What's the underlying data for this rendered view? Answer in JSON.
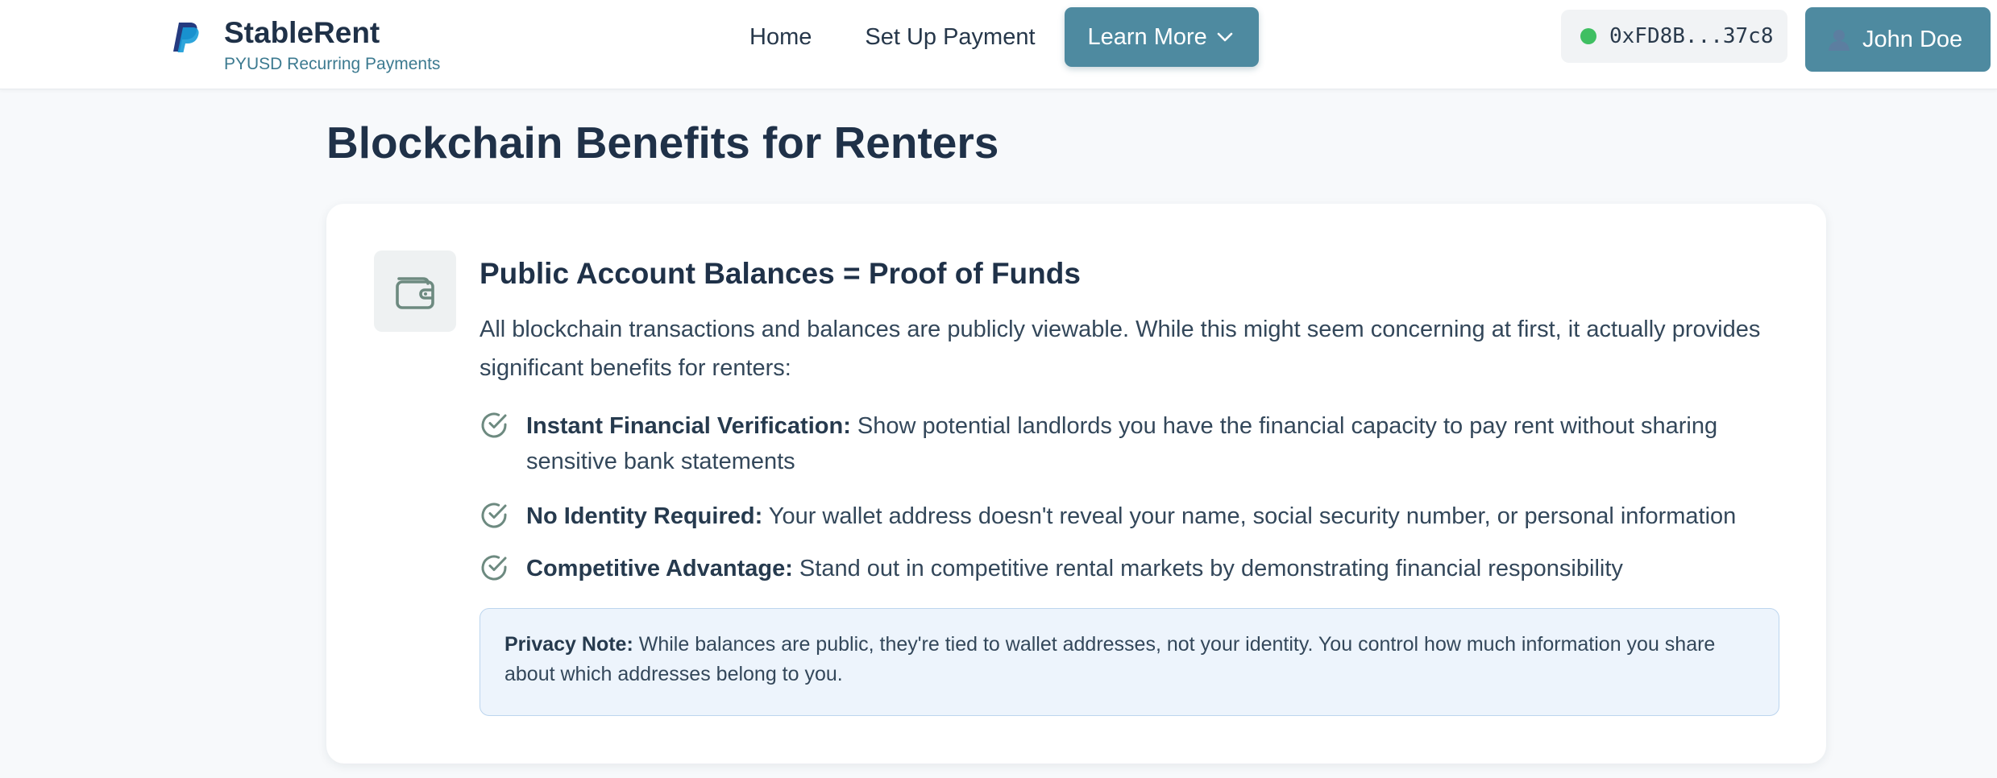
{
  "header": {
    "brand_name": "StableRent",
    "brand_subtitle": "PYUSD Recurring Payments",
    "logo_icon": "paypal-logo-icon",
    "nav": {
      "home_label": "Home",
      "setup_label": "Set Up Payment",
      "learn_more_label": "Learn More"
    },
    "wallet": {
      "address": "0xFD8B...37c8",
      "status": "connected",
      "status_color": "#3fbf62"
    },
    "user": {
      "name": "John Doe",
      "icon": "user-avatar-icon"
    }
  },
  "main": {
    "page_title": "Blockchain Benefits for Renters",
    "card": {
      "icon": "wallet-icon",
      "title": "Public Account Balances = Proof of Funds",
      "description": "All blockchain transactions and balances are publicly viewable. While this might seem concerning at first, it actually provides significant benefits for renters:",
      "benefits": [
        {
          "title": "Instant Financial Verification:",
          "text": " Show potential landlords you have the financial capacity to pay rent without sharing sensitive bank statements",
          "icon": "check-circle-icon"
        },
        {
          "title": "No Identity Required:",
          "text": " Your wallet address doesn't reveal your name, social security number, or personal information",
          "icon": "check-circle-icon"
        },
        {
          "title": "Competitive Advantage:",
          "text": " Stand out in competitive rental markets by demonstrating financial responsibility",
          "icon": "check-circle-icon"
        }
      ],
      "privacy_note": {
        "label": "Privacy Note:",
        "text": " While balances are public, they're tied to wallet addresses, not your identity. You control how much information you share about which addresses belong to you."
      }
    }
  },
  "colors": {
    "accent": "#4e8aa0",
    "heading": "#1f3148",
    "note_background": "#edf4fc"
  }
}
